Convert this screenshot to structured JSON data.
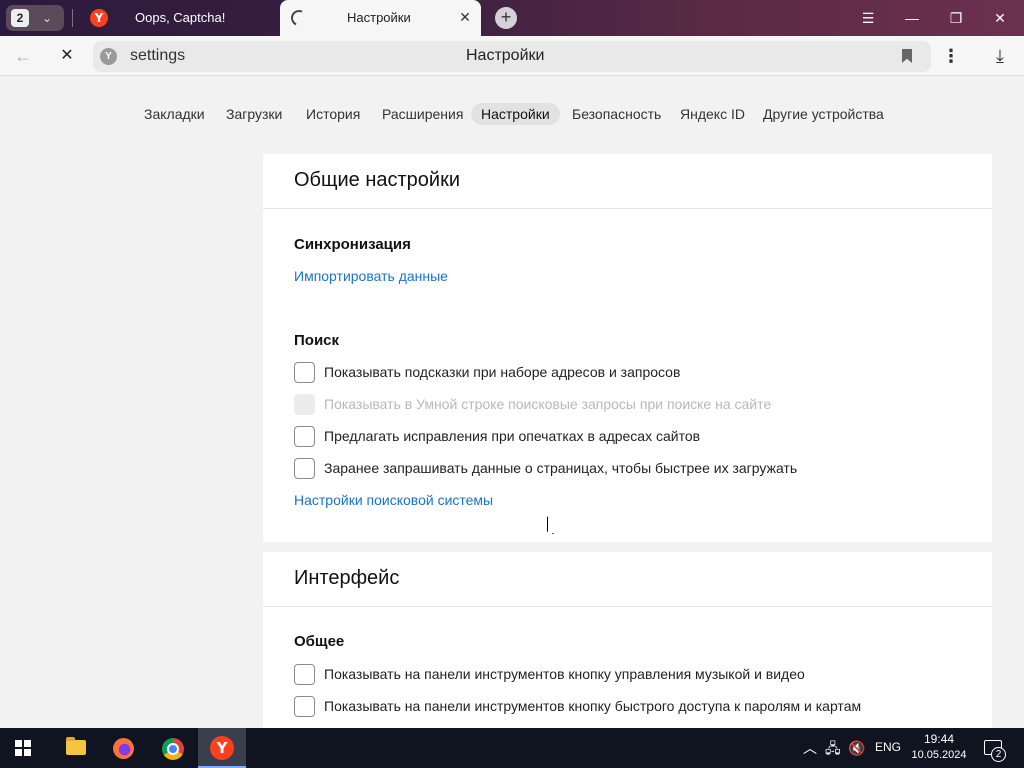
{
  "browser": {
    "tab_count": "2",
    "tabs": [
      {
        "title": "Oops, Captcha!",
        "favicon": "yandex-icon"
      },
      {
        "title": "Настройки",
        "favicon": "loading-spinner-icon",
        "active": true
      }
    ],
    "window_controls": [
      "menu-icon",
      "minimize-icon",
      "restore-icon",
      "close-icon"
    ]
  },
  "address_bar": {
    "url": "settings",
    "page_title": "Настройки"
  },
  "settings_nav": {
    "items": [
      "Закладки",
      "Загрузки",
      "История",
      "Расширения",
      "Настройки",
      "Безопасность",
      "Яндекс ID",
      "Другие устройства"
    ],
    "active_index": 4
  },
  "general": {
    "title": "Общие настройки",
    "sync": {
      "title": "Синхронизация",
      "import_link": "Импортировать данные"
    },
    "search": {
      "title": "Поиск",
      "options": [
        {
          "label": "Показывать подсказки при наборе адресов и запросов",
          "checked": false,
          "disabled": false
        },
        {
          "label": "Показывать в Умной строке поисковые запросы при поиске на сайте",
          "checked": false,
          "disabled": true
        },
        {
          "label": "Предлагать исправления при опечатках в адресах сайтов",
          "checked": false,
          "disabled": false
        },
        {
          "label": "Заранее запрашивать данные о страницах, чтобы быстрее их загружать",
          "checked": false,
          "disabled": false
        }
      ],
      "engine_link": "Настройки поисковой системы"
    }
  },
  "interface": {
    "title": "Интерфейс",
    "general": {
      "title": "Общее",
      "options": [
        {
          "label": "Показывать на панели инструментов кнопку управления музыкой и видео",
          "checked": false
        },
        {
          "label": "Показывать на панели инструментов кнопку быстрого доступа к паролям и картам",
          "checked": false
        }
      ]
    }
  },
  "taskbar": {
    "apps": [
      "file-explorer-icon",
      "firefox-icon",
      "chrome-icon",
      "yandex-browser-icon"
    ],
    "language": "ENG",
    "time": "19:44",
    "date": "10.05.2024",
    "notifications": "2"
  },
  "colors": {
    "link": "#1a73c9",
    "titlebar": "#3a2040",
    "yandex_red": "#fc3f1d",
    "taskbar": "#101420"
  }
}
